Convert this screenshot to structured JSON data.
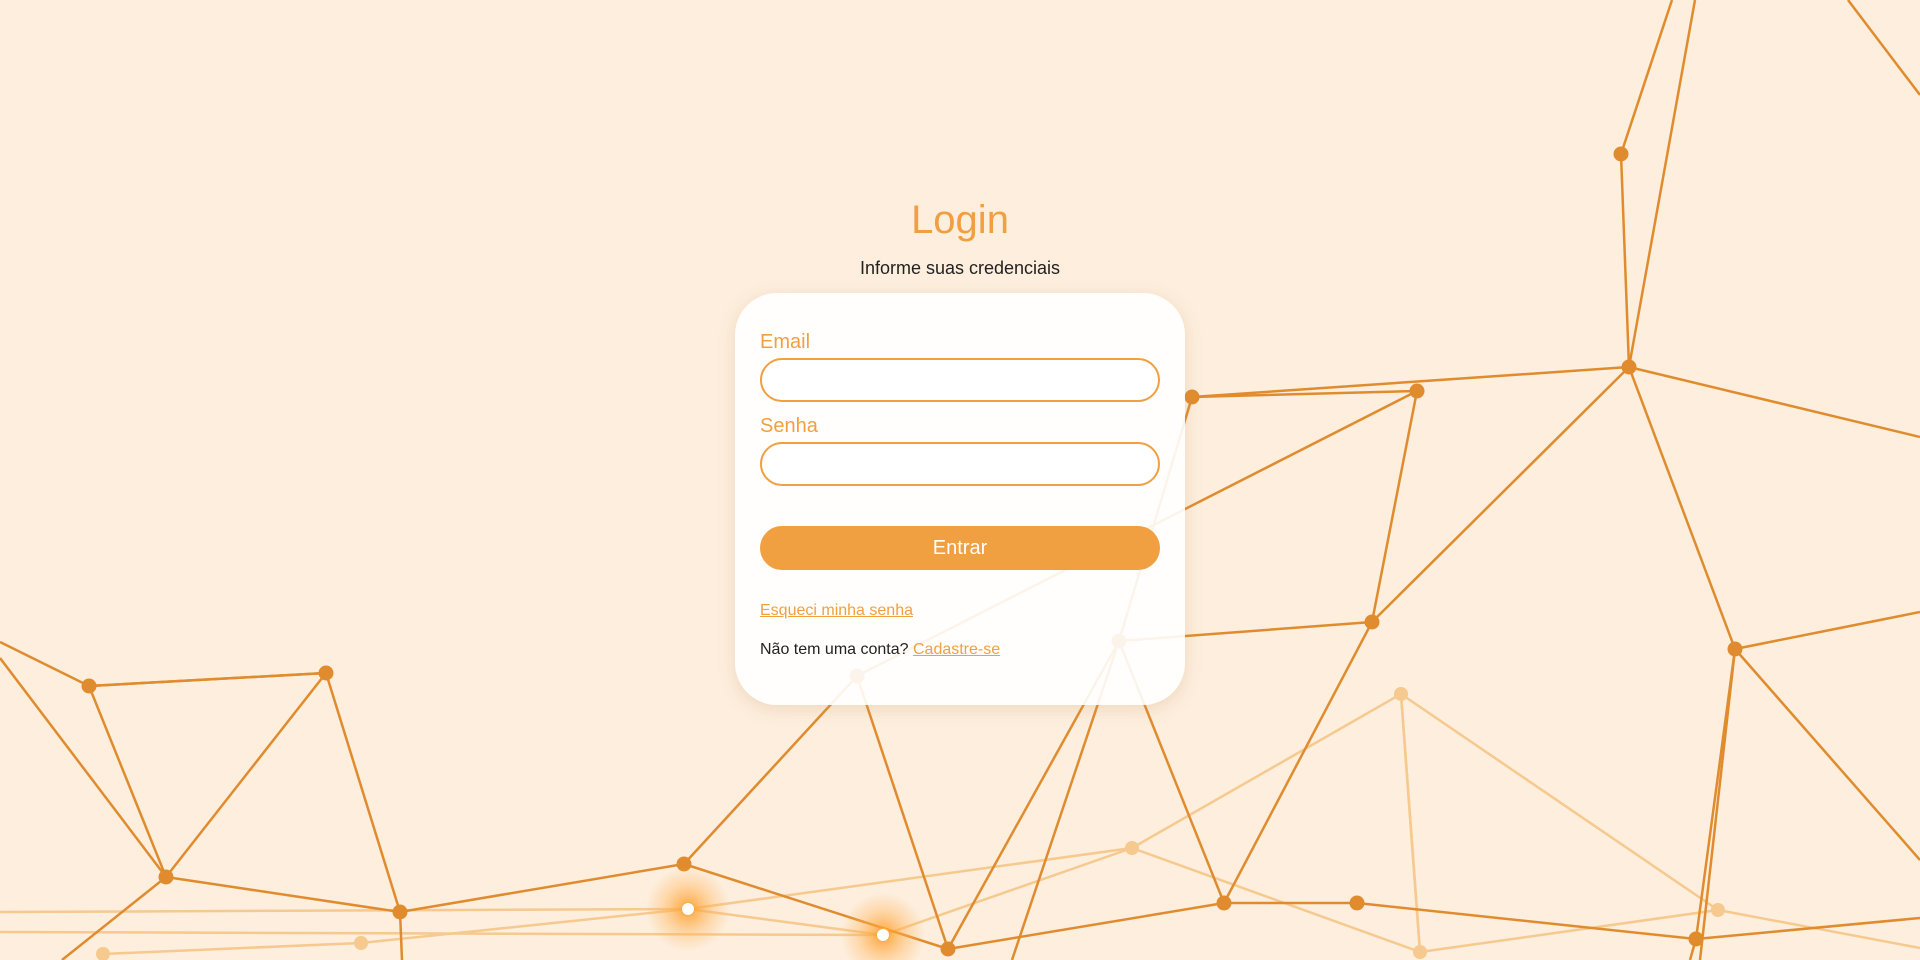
{
  "login": {
    "title": "Login",
    "subtitle": "Informe suas credenciais"
  },
  "form": {
    "email_label": "Email",
    "email_value": "",
    "password_label": "Senha",
    "password_value": "",
    "submit_label": "Entrar",
    "forgot_link": "Esqueci minha senha",
    "signup_prompt": "Não tem uma conta?",
    "signup_link": "Cadastre-se"
  },
  "colors": {
    "background": "#fdeedd",
    "accent": "#f0a040",
    "network_line": "#e08c2e",
    "network_faint": "#f6c98e"
  }
}
